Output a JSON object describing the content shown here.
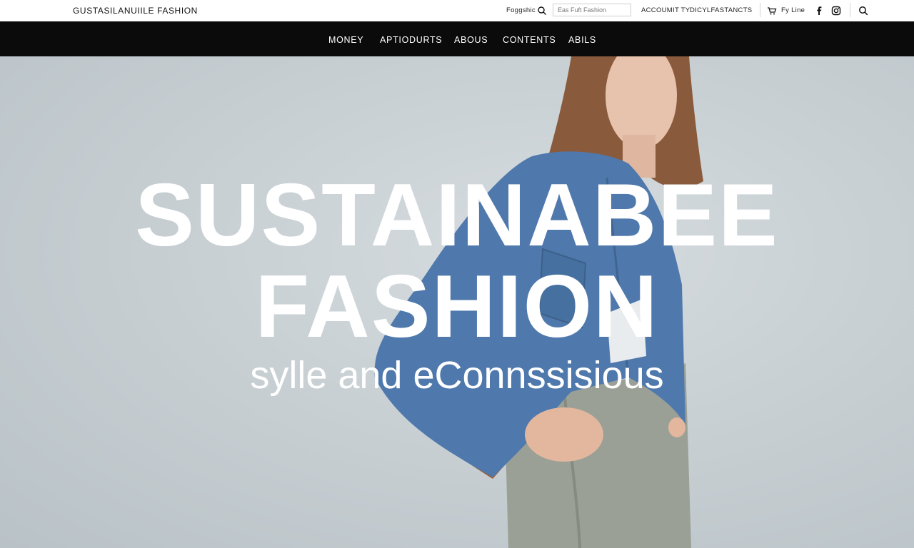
{
  "topbar": {
    "brand": "GUSTASILANUIILE FASHION",
    "language": "Foggshic",
    "search_placeholder": "Eas Fuft Fashion",
    "account": "ACCOUMIT TY",
    "shop": "DICYLFASTANCTS",
    "cart": "Fy Line"
  },
  "nav": {
    "items": [
      "MONEY",
      "APTIODURTS",
      "ABOUS",
      "CONTENTS",
      "ABILS"
    ]
  },
  "hero": {
    "line1": "SUSTAINABEE",
    "line2": "FASHION",
    "tagline": "sylle and eConnssisious"
  },
  "icons": {
    "search": "search-icon",
    "cart": "cart-icon",
    "facebook": "facebook-icon",
    "instagram": "instagram-icon"
  },
  "colors": {
    "nav_bg": "#0b0b0b",
    "hero_bg": "#c7cfd3",
    "denim": "#4f79ad",
    "trousers": "#9aa096"
  }
}
